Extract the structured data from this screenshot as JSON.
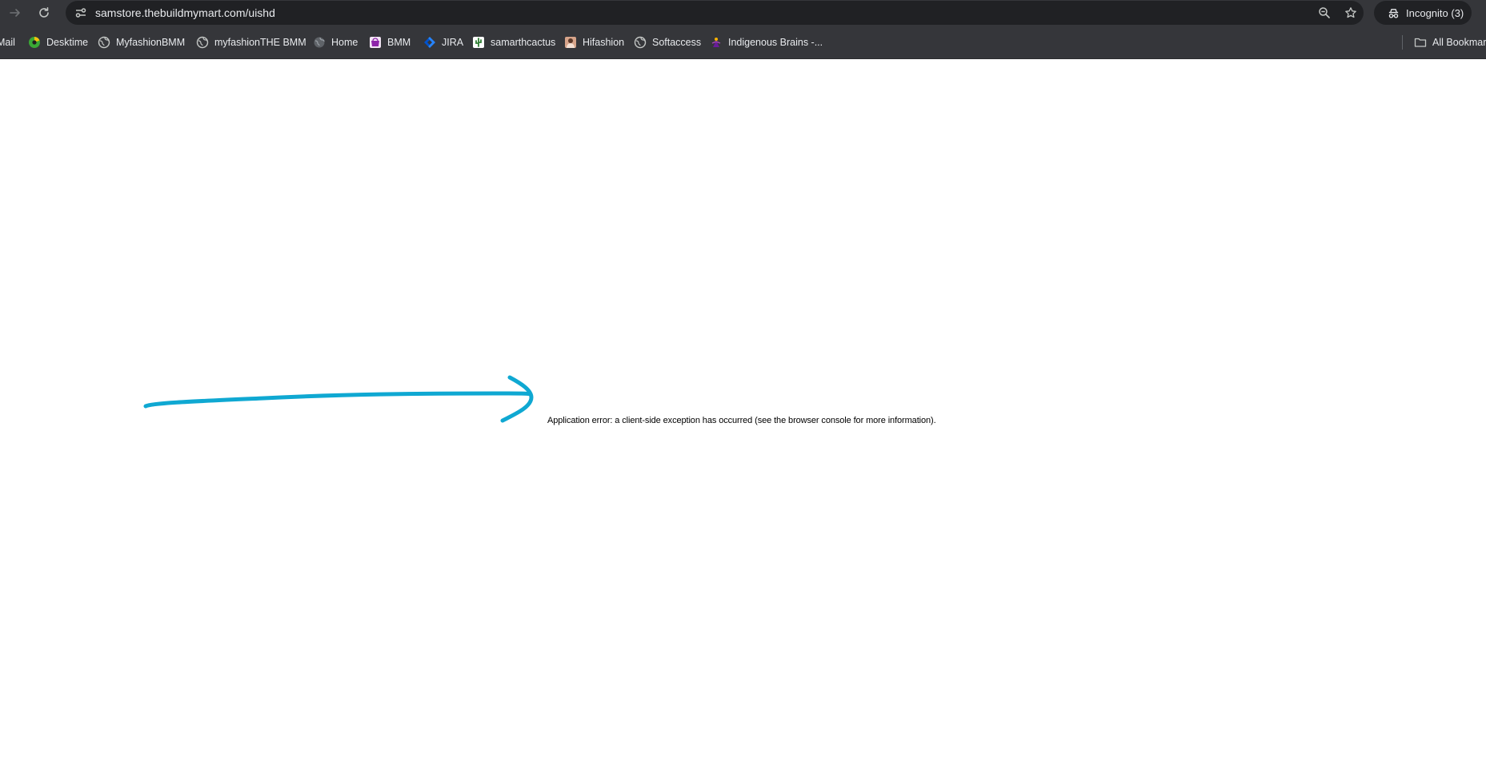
{
  "browser": {
    "url_host": "samstore.thebuildmymart.com",
    "url_path": "/uishd",
    "incognito_label": "Incognito (3)"
  },
  "bookmarks": {
    "items": [
      {
        "label": "Mail",
        "icon": "mail-icon"
      },
      {
        "label": "Desktime",
        "icon": "desktime-icon"
      },
      {
        "label": "MyfashionBMM",
        "icon": "globe-icon"
      },
      {
        "label": "myfashionTHE BMM",
        "icon": "globe-icon"
      },
      {
        "label": "Home",
        "icon": "globe-icon"
      },
      {
        "label": "BMM",
        "icon": "bmm-logo-icon"
      },
      {
        "label": "JIRA",
        "icon": "jira-icon"
      },
      {
        "label": "samarthcactus",
        "icon": "cactus-icon"
      },
      {
        "label": "Hifashion",
        "icon": "hifashion-icon"
      },
      {
        "label": "Softaccess",
        "icon": "globe-icon"
      },
      {
        "label": "Indigenous Brains -...",
        "icon": "indigenous-brains-icon"
      }
    ],
    "all_bookmarks_label": "All Bookmarks"
  },
  "page": {
    "error_message": "Application error: a client-side exception has occurred (see the browser console for more information)."
  },
  "colors": {
    "annotation_arrow": "#0fa8d2",
    "chrome_bg": "#35363a",
    "omnibox_bg": "#202124"
  }
}
